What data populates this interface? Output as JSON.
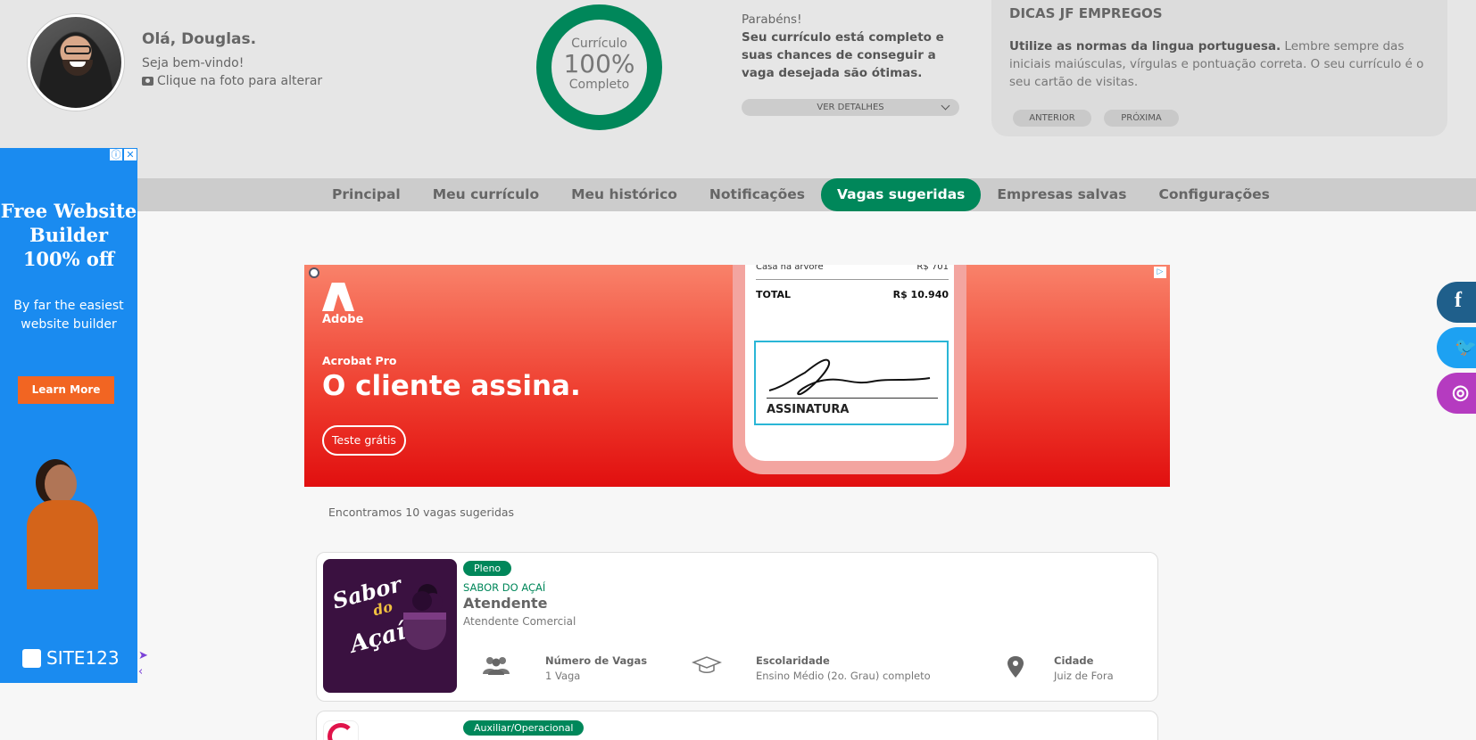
{
  "profile": {
    "greeting": "Olá, Douglas.",
    "welcome": "Seja bem-vindo!",
    "photo_hint": "Clique na foto para alterar"
  },
  "progress": {
    "label_top": "Currículo",
    "percent_text": "100%",
    "percent": 100,
    "label_bottom": "Completo",
    "color": "#00875a"
  },
  "congrats": {
    "title": "Parabéns!",
    "message": "Seu currículo está completo e suas chances de conseguir a vaga desejada são ótimas.",
    "details_button": "VER DETALHES"
  },
  "tips": {
    "title": "DICAS JF EMPREGOS",
    "bold": "Utilize as normas da lingua portuguesa.",
    "text": "Lembre sempre das iniciais maiúsculas, vírgulas e pontuação correta. O seu currículo é o seu cartão de visitas.",
    "prev": "ANTERIOR",
    "next": "PRÓXIMA"
  },
  "side_ad": {
    "headline": "Free Website Builder 100% off",
    "sub": "By far the easiest website builder",
    "cta": "Learn More",
    "brand": "SITE123",
    "color": "#1a8bf0",
    "cta_color": "#f26522"
  },
  "nav": {
    "items": [
      "Principal",
      "Meu currículo",
      "Meu histórico",
      "Notificações",
      "Vagas sugeridas",
      "Empresas salvas",
      "Configurações"
    ],
    "active": "Vagas sugeridas",
    "active_color": "#00875a"
  },
  "social": [
    {
      "name": "facebook-icon",
      "glyph": "f",
      "color": "#1f5f8b"
    },
    {
      "name": "twitter-icon",
      "glyph": "t",
      "color": "#1da1f2"
    },
    {
      "name": "instagram-icon",
      "glyph": "◎",
      "color": "#b53bc0"
    }
  ],
  "banner_ad": {
    "brand": "Adobe",
    "product": "Acrobat Pro",
    "headline": "O cliente assina.",
    "cta": "Teste grátis",
    "receipt_item": "Casa na árvore",
    "receipt_item_value": "R$ 701",
    "receipt_total_label": "TOTAL",
    "receipt_total_value": "R$ 10.940",
    "signature_label": "ASSINATURA"
  },
  "results": {
    "found_text": "Encontramos 10 vagas sugeridas"
  },
  "jobs": [
    {
      "level": "Pleno",
      "company": "SABOR DO AÇAÍ",
      "title": "Atendente",
      "subtitle": "Atendente Comercial",
      "logo_text_1": "Sabor",
      "logo_text_2": "do",
      "logo_text_3": "Açaí",
      "vacancies_label": "Número de Vagas",
      "vacancies": "1 Vaga",
      "education_label": "Escolaridade",
      "education": "Ensino Médio (2o. Grau) completo",
      "city_label": "Cidade",
      "city": "Juiz de Fora"
    },
    {
      "level": "Auxiliar/Operacional"
    }
  ]
}
